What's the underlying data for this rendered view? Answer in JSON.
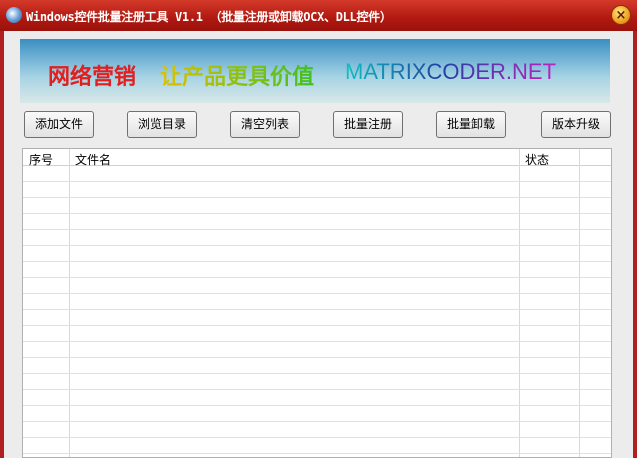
{
  "window": {
    "title": "Windows控件批量注册工具 V1.1 （批量注册或卸载OCX、DLL控件）",
    "close_label": "×"
  },
  "banner": {
    "text1": "网络营销",
    "text2": "让产品更具价值",
    "text3": "MATRIXCODER.NET"
  },
  "toolbar": {
    "buttons": [
      "添加文件",
      "浏览目录",
      "清空列表",
      "批量注册",
      "批量卸载",
      "版本升级"
    ]
  },
  "table": {
    "columns": [
      "序号",
      "文件名",
      "状态"
    ],
    "rows": []
  }
}
